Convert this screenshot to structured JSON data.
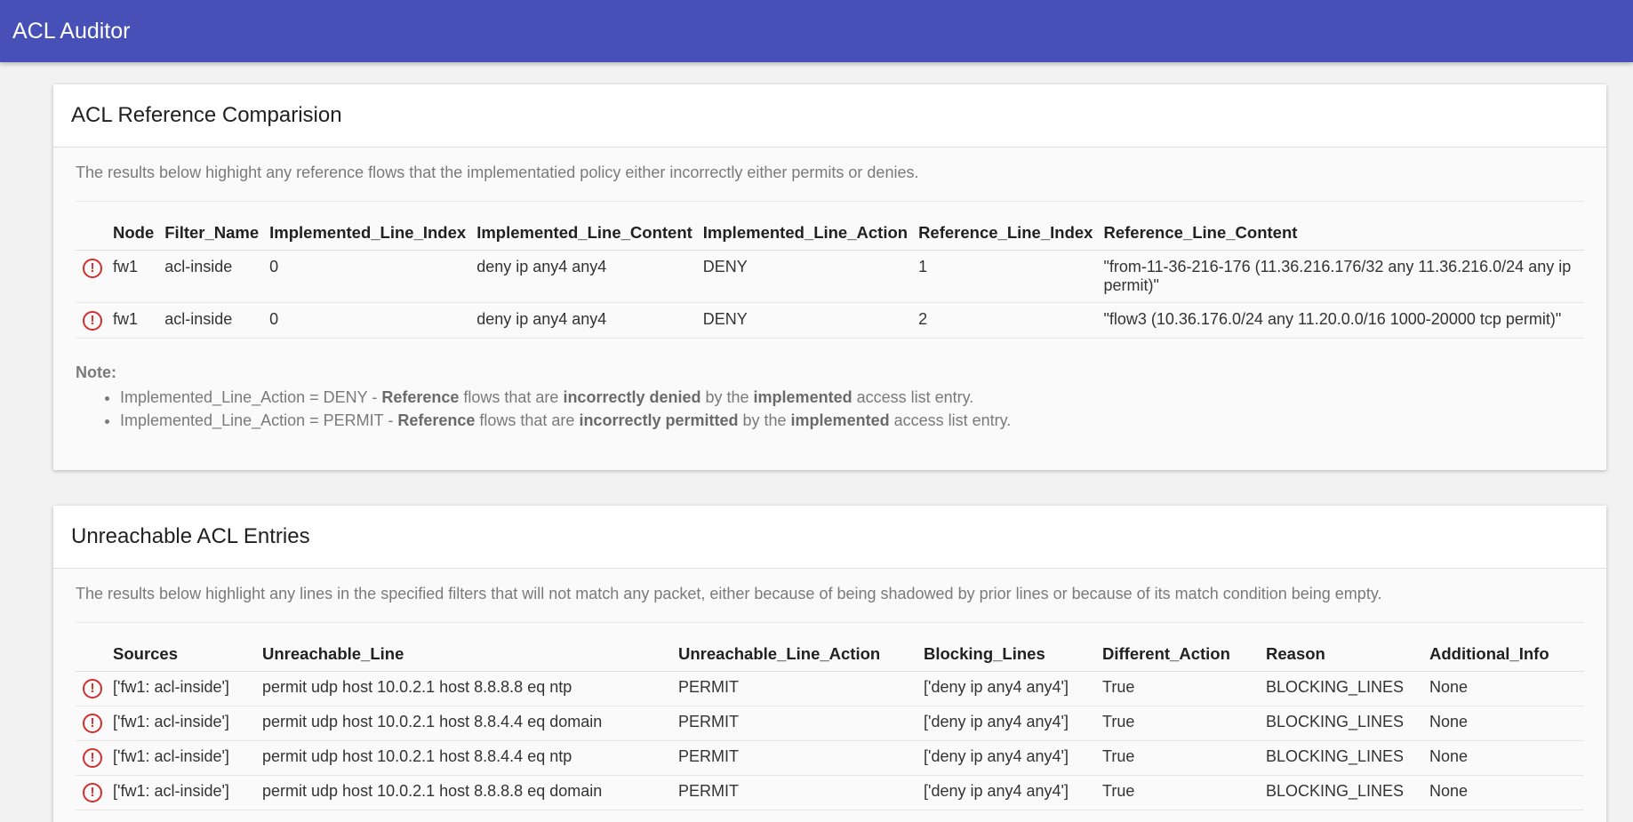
{
  "app": {
    "title": "ACL Auditor"
  },
  "comparison": {
    "title": "ACL Reference Comparision",
    "description": "The results below highight any reference flows that the implementatied policy either incorrectly either permits or denies.",
    "columns": [
      "Node",
      "Filter_Name",
      "Implemented_Line_Index",
      "Implemented_Line_Content",
      "Implemented_Line_Action",
      "Reference_Line_Index",
      "Reference_Line_Content"
    ],
    "rows": [
      {
        "node": "fw1",
        "filter": "acl-inside",
        "impl_index": "0",
        "impl_content": "deny ip any4 any4",
        "impl_action": "DENY",
        "ref_index": "1",
        "ref_content": "\"from-11-36-216-176 (11.36.216.176/32 any 11.36.216.0/24 any ip permit)\""
      },
      {
        "node": "fw1",
        "filter": "acl-inside",
        "impl_index": "0",
        "impl_content": "deny ip any4 any4",
        "impl_action": "DENY",
        "ref_index": "2",
        "ref_content": "\"flow3 (10.36.176.0/24 any 11.20.0.0/16 1000-20000 tcp permit)\""
      }
    ],
    "note": {
      "title": "Note:",
      "item1": {
        "prefix": "Implemented_Line_Action = DENY - ",
        "b1": "Reference",
        "t1": " flows that are ",
        "b2": "incorrectly denied",
        "t2": " by the ",
        "b3": "implemented",
        "t3": " access list entry."
      },
      "item2": {
        "prefix": "Implemented_Line_Action = PERMIT - ",
        "b1": "Reference",
        "t1": " flows that are ",
        "b2": "incorrectly permitted",
        "t2": " by the ",
        "b3": "implemented",
        "t3": " access list entry."
      }
    }
  },
  "unreachable": {
    "title": "Unreachable ACL Entries",
    "description": "The results below highlight any lines in the specified filters that will not match any packet, either because of being shadowed by prior lines or because of its match condition being empty.",
    "columns": [
      "Sources",
      "Unreachable_Line",
      "Unreachable_Line_Action",
      "Blocking_Lines",
      "Different_Action",
      "Reason",
      "Additional_Info"
    ],
    "rows": [
      {
        "sources": "['fw1: acl-inside']",
        "line": "permit udp host 10.0.2.1 host 8.8.8.8 eq ntp",
        "action": "PERMIT",
        "blocking": "['deny ip any4 any4']",
        "diff": "True",
        "reason": "BLOCKING_LINES",
        "info": "None"
      },
      {
        "sources": "['fw1: acl-inside']",
        "line": "permit udp host 10.0.2.1 host 8.8.4.4 eq domain",
        "action": "PERMIT",
        "blocking": "['deny ip any4 any4']",
        "diff": "True",
        "reason": "BLOCKING_LINES",
        "info": "None"
      },
      {
        "sources": "['fw1: acl-inside']",
        "line": "permit udp host 10.0.2.1 host 8.8.4.4 eq ntp",
        "action": "PERMIT",
        "blocking": "['deny ip any4 any4']",
        "diff": "True",
        "reason": "BLOCKING_LINES",
        "info": "None"
      },
      {
        "sources": "['fw1: acl-inside']",
        "line": "permit udp host 10.0.2.1 host 8.8.8.8 eq domain",
        "action": "PERMIT",
        "blocking": "['deny ip any4 any4']",
        "diff": "True",
        "reason": "BLOCKING_LINES",
        "info": "None"
      }
    ]
  },
  "icons": {
    "error": "error-circle-icon",
    "error_glyph": "!",
    "error_color": "#d32f2f"
  },
  "colors": {
    "appbar": "#4650b6"
  }
}
